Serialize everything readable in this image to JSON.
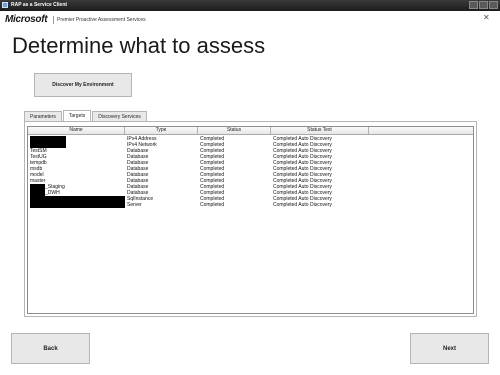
{
  "window": {
    "title": "RAP as a Service Client"
  },
  "brand": {
    "logo": "Microsoft",
    "subtitle": "Premier Proactive Assessment Services"
  },
  "page": {
    "title": "Determine what to assess"
  },
  "buttons": {
    "discover": "Discover My Environment",
    "back": "Back",
    "next": "Next"
  },
  "tabs": [
    {
      "label": "Parameters",
      "active": false
    },
    {
      "label": "Targets",
      "active": true
    },
    {
      "label": "Discovery Services",
      "active": false
    }
  ],
  "grid": {
    "columns": [
      "Name",
      "Type",
      "Status",
      "Status Text",
      ""
    ],
    "rows": [
      {
        "name": "",
        "redacted": true,
        "type": "IPv4 Address",
        "status": "Completed",
        "status_text": "Completed Auto Discovery"
      },
      {
        "name": "",
        "redacted": true,
        "type": "IPv4 Network",
        "status": "Completed",
        "status_text": "Completed Auto Discovery"
      },
      {
        "name": "TestSM",
        "type": "Database",
        "status": "Completed",
        "status_text": "Completed Auto Discovery"
      },
      {
        "name": "TestUG",
        "type": "Database",
        "status": "Completed",
        "status_text": "Completed Auto Discovery"
      },
      {
        "name": "tempdb",
        "type": "Database",
        "status": "Completed",
        "status_text": "Completed Auto Discovery"
      },
      {
        "name": "msdb",
        "type": "Database",
        "status": "Completed",
        "status_text": "Completed Auto Discovery"
      },
      {
        "name": "model",
        "type": "Database",
        "status": "Completed",
        "status_text": "Completed Auto Discovery"
      },
      {
        "name": "master",
        "type": "Database",
        "status": "Completed",
        "status_text": "Completed Auto Discovery"
      },
      {
        "name": "_Staging",
        "redacted_prefix": true,
        "type": "Database",
        "status": "Completed",
        "status_text": "Completed Auto Discovery"
      },
      {
        "name": "_DWH",
        "redacted_prefix": true,
        "type": "Database",
        "status": "Completed",
        "status_text": "Completed Auto Discovery"
      },
      {
        "name": "",
        "redacted": true,
        "type": "SqlInstance",
        "status": "Completed",
        "status_text": "Completed Auto Discovery"
      },
      {
        "name": "",
        "redacted": true,
        "type": "Server",
        "status": "Completed",
        "status_text": "Completed Auto Discovery"
      }
    ]
  }
}
